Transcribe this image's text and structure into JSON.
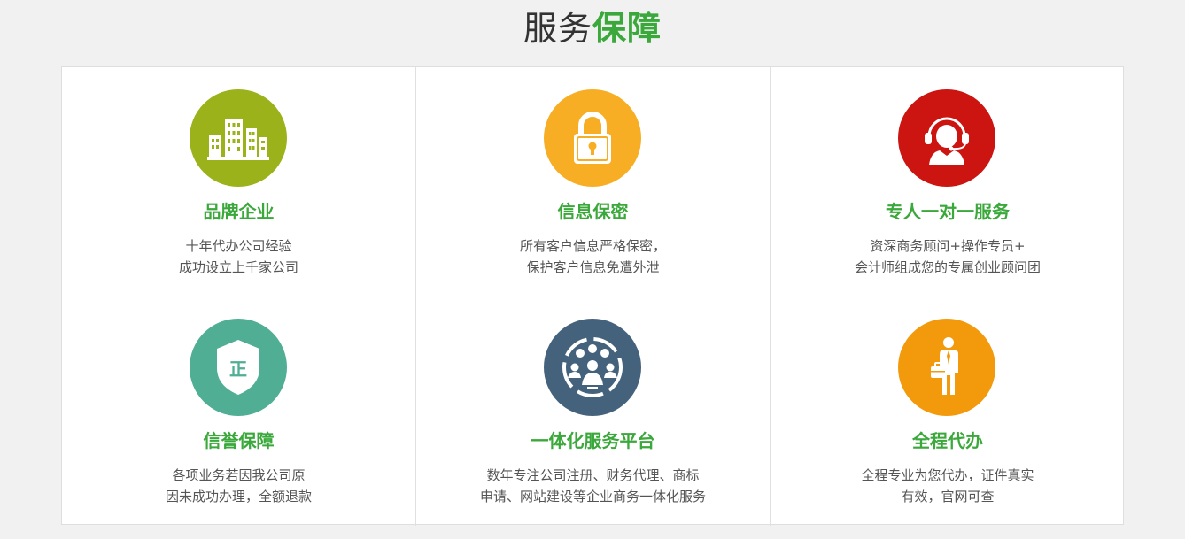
{
  "header": {
    "title_plain": "服务",
    "title_highlight": "保障"
  },
  "colors": {
    "accent_green": "#3aa83a"
  },
  "cards": [
    {
      "title": "品牌企业",
      "lines": [
        "十年代办公司经验",
        "成功设立上千家公司"
      ],
      "icon": "buildings-icon",
      "color": "#9bb21b"
    },
    {
      "title": "信息保密",
      "lines": [
        "所有客户信息严格保密，",
        "保护客户信息免遭外泄"
      ],
      "icon": "lock-icon",
      "color": "#f7ae25"
    },
    {
      "title": "专人一对一服务",
      "lines": [
        "资深商务顾问+操作专员+",
        "会计师组成您的专属创业顾问团"
      ],
      "icon": "headset-agent-icon",
      "color": "#cc1410"
    },
    {
      "title": "信誉保障",
      "lines": [
        "各项业务若因我公司原",
        "因未成功办理，全额退款"
      ],
      "icon": "shield-icon",
      "shield_text": "正",
      "color": "#4fae93"
    },
    {
      "title": "一体化服务平台",
      "lines": [
        "数年专注公司注册、财务代理、商标",
        "申请、网站建设等企业商务一体化服务"
      ],
      "icon": "team-network-icon",
      "color": "#45627c"
    },
    {
      "title": "全程代办",
      "lines": [
        "全程专业为您代办，证件真实",
        "有效，官网可查"
      ],
      "icon": "businessman-icon",
      "color": "#f29a0c"
    }
  ]
}
